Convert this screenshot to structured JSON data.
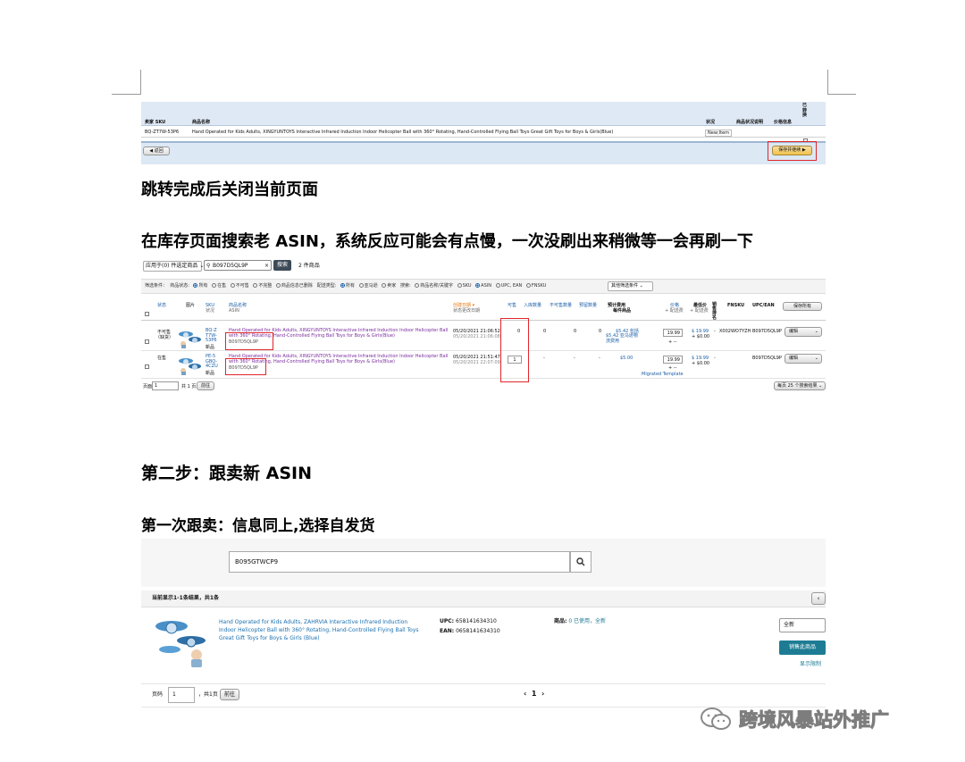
{
  "headings": {
    "h1": "跳转完成后关闭当前页面",
    "h2": "在库存页面搜索老 ASIN，系统反应可能会有点慢，一次没刷出来稍微等一会再刷一下",
    "h3": "第二步：跟卖新 ASIN",
    "h4": "第一次跟卖：信息同上,选择自发货"
  },
  "shot1": {
    "col_sku": "卖家 SKU",
    "col_name": "商品名称",
    "col_status": "状况",
    "col_cond": "商品状况说明",
    "col_price": "价格信息",
    "col_conv": "已转换",
    "row_sku": "BQ-ZT7W-53P6",
    "row_name": "Hand Operated for Kids Adults, XINGYUNTOYS Interactive Infrared Induction Indoor Helicopter Ball with 360° Rotating, Hand-Controlled Flying Ball Toys Great Gift Toys for Boys & Girls(Blue)",
    "row_status": "New;Item",
    "back_btn": "返回",
    "save_btn": "保存并继续"
  },
  "shot2": {
    "filter_select": "应用于(0) 件选定商品",
    "search_value": "B097D5QL9P",
    "search_btn": "搜索",
    "result_count": "2 件商品",
    "filter_label": "筛选条件：",
    "listing_status": "商品状态:",
    "opt_all": "所有",
    "opt_active": "在售",
    "opt_inactive": "不可售",
    "opt_incomplete": "不完整",
    "opt_suppressed": "商品信息已删除",
    "fulfill_label": "配送类型:",
    "opt_fba": "亚马逊",
    "opt_mfn": "卖家",
    "search_in": "搜索:",
    "opt_title": "商品名称/关键字",
    "opt_sku": "SKU",
    "opt_asin": "ASIN",
    "opt_upc": "UPC, EAN",
    "opt_fnsku": "FNSKU",
    "more_filters": "其他筛选条件",
    "cols": {
      "status": "状态",
      "image": "图片",
      "sku": "SKU",
      "sku_sub": "状况",
      "name": "商品名称",
      "name_sub": "ASIN",
      "date": "创建日期",
      "date_sub": "状态更改日期",
      "available": "可售",
      "inbound": "入库数量",
      "unfulfillable": "不可售数量",
      "reserved": "预留数量",
      "fee": "预计费用",
      "fee_sub": "每件商品",
      "price": "价格",
      "price_sub": "+ 配送费",
      "lowest": "最低价",
      "lowest_sub": "+ 配送费",
      "sales": "销售排名",
      "fnsku": "FNSKU",
      "upc": "UPC/EAN",
      "save_all": "保存所有"
    },
    "rows": [
      {
        "status": "不可售",
        "status_sub": "（缺货）",
        "sku": "BQ-ZT7W-53P6",
        "sku_sub": "新品",
        "name": "Hand Operated for Kids Adults, XINGYUNTOYS Interactive Infrared Induction Indoor Helicopter Ball with 360° Rotating, Hand-Controlled Flying Ball Toys for Boys & Girls(Blue)",
        "asin": "B097D5QL9P",
        "date": "05/20/2021 21:06:52",
        "date_sub": "05/20/2021 21:06:08",
        "available": "0",
        "inbound": "0",
        "unfulfillable": "0",
        "reserved": "0",
        "fee": "$5.42 包括",
        "fee_sub": "$5.42 亚马逊物流费用",
        "price": "19.99",
        "price_sub": "+ --",
        "lowest": "$ 19.99",
        "lowest_sub": "+ $0.00",
        "sales": "-",
        "fnsku": "X002WO7YZH",
        "upc": "B097D5QL9P",
        "action": "编辑"
      },
      {
        "status": "在售",
        "status_sub": "",
        "sku": "PE-5GBQ-4CZU",
        "sku_sub": "新品",
        "name": "Hand Operated for Kids Adults, XINGYUNTOYS Interactive Infrared Induction Indoor Helicopter Ball with 360° Rotating, Hand-Controlled Flying Ball Toys for Boys & Girls(Blue)",
        "asin": "B097D5QL9P",
        "date": "05/20/2021 21:51:47",
        "date_sub": "05/20/2021 22:07:09",
        "available": "1",
        "inbound": "-",
        "unfulfillable": "-",
        "reserved": "-",
        "fee": "$5.00",
        "fee_sub": "Migrated Template",
        "price": "19.99",
        "price_sub": "+ --",
        "lowest": "$ 19.99",
        "lowest_sub": "+ $0.00",
        "sales": "-",
        "fnsku": "",
        "upc": "B097D5QL9P",
        "action": "编辑"
      }
    ],
    "page_label": "页面",
    "page_value": "1",
    "page_total": "共 1 页",
    "page_go": "前往",
    "per_page": "每页 25 个搜索结果"
  },
  "shot3": {
    "search_value": "B095GTWCP9",
    "result_summary": "当前显示1-1条结果，共1条",
    "product_title": "Hand Operated for Kids Adults, ZAHRVIA Interactive Infrared Induction Indoor Helicopter Ball with 360° Rotating, Hand-Controlled Flying Ball Toys Great Gift Toys for Boys & Girls (Blue)",
    "upc_label": "UPC:",
    "upc_value": "658141634310",
    "ean_label": "EAN:",
    "ean_value": "0658141634310",
    "offers_label": "商品:",
    "offers_value": "0 已使用，全新",
    "condition_value": "全新",
    "sell_btn": "销售此商品",
    "limits_link": "显示限制",
    "page_label": "页码",
    "page_value": "1",
    "page_total": "，共1页",
    "page_go": "前往",
    "pager_prev": "‹",
    "pager_num": "1",
    "pager_next": "›"
  },
  "watermark": {
    "text": "跨境风暴站外推广"
  },
  "colors": {
    "header_blue": "#dfe9f5",
    "footer_blue": "#dce8f4",
    "red_box": "#e0262b",
    "link_purple": "#7a2c9e",
    "teal_button": "#1d7c94",
    "orange_button": "#f0c14b"
  }
}
